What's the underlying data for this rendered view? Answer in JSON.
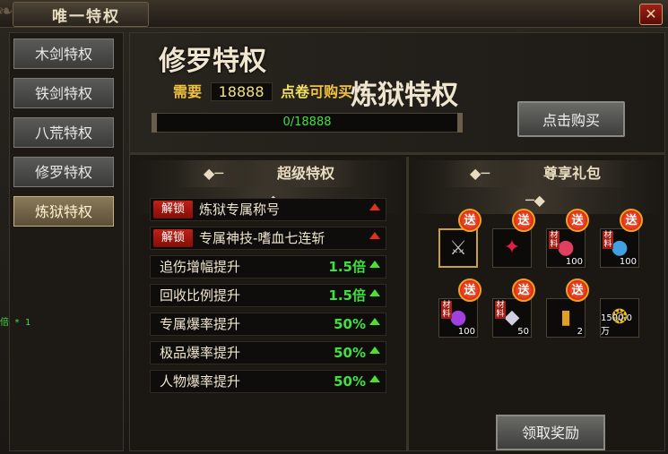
{
  "window": {
    "title": "唯一特权",
    "close_icon": "✕"
  },
  "nav": {
    "items": [
      {
        "label": "木剑特权",
        "active": false
      },
      {
        "label": "铁剑特权",
        "active": false
      },
      {
        "label": "八荒特权",
        "active": false
      },
      {
        "label": "修罗特权",
        "active": false
      },
      {
        "label": "炼狱特权",
        "active": true
      }
    ]
  },
  "header": {
    "current_privilege": "修罗特权",
    "need_prefix": "需要",
    "need_amount": "18888",
    "need_suffix_1": "点卷",
    "need_suffix_2": "可购买",
    "target_privilege": "炼狱特权",
    "progress_text": "0/18888",
    "progress_fraction": 0,
    "buy_label": "点击购买"
  },
  "super": {
    "title": "超级特权",
    "unlock_rows": [
      {
        "badge": "解锁",
        "label": "炼狱专属称号"
      },
      {
        "badge": "解锁",
        "label": "专属神技-嗜血七连斩"
      }
    ],
    "stat_rows": [
      {
        "label": "追伤增幅提升",
        "value": "1.5倍"
      },
      {
        "label": "回收比例提升",
        "value": "1.5倍"
      },
      {
        "label": "专属爆率提升",
        "value": "50%"
      },
      {
        "label": "极品爆率提升",
        "value": "50%"
      },
      {
        "label": "人物爆率提升",
        "value": "50%"
      }
    ]
  },
  "gift": {
    "title": "尊享礼包",
    "badge": "送",
    "material_tag": "材料",
    "items": [
      {
        "icon": "halberd-icon",
        "glyph": "⚔",
        "color": "#c0c0c0",
        "count": "",
        "material": false,
        "badge": true
      },
      {
        "icon": "red-gem-icon",
        "glyph": "✦",
        "color": "#e02040",
        "count": "",
        "material": false,
        "badge": true
      },
      {
        "icon": "red-orb-icon",
        "glyph": "●",
        "color": "#e04060",
        "count": "100",
        "material": true,
        "badge": true
      },
      {
        "icon": "blue-orb-icon",
        "glyph": "●",
        "color": "#40a0e0",
        "count": "100",
        "material": true,
        "badge": true
      },
      {
        "icon": "purple-orb-icon",
        "glyph": "●",
        "color": "#a040e0",
        "count": "100",
        "material": true,
        "badge": true
      },
      {
        "icon": "crystal-icon",
        "glyph": "◆",
        "color": "#d0d0e0",
        "count": "50",
        "material": true,
        "badge": true
      },
      {
        "icon": "scroll-icon",
        "glyph": "▮",
        "color": "#e0a020",
        "count": "2",
        "material": false,
        "badge": true
      },
      {
        "icon": "gold-coins-icon",
        "glyph": "❂",
        "color": "#f0c020",
        "count": "1500.0万",
        "material": false,
        "badge": false
      }
    ],
    "claim_label": "领取奖励"
  },
  "stray_text": "倍 * 1"
}
